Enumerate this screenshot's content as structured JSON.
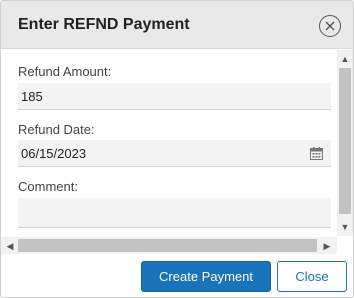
{
  "dialog": {
    "title": "Enter REFND Payment",
    "close_icon": "close-circle-icon"
  },
  "form": {
    "refund_amount_label": "Refund Amount:",
    "refund_amount_value": "185",
    "refund_date_label": "Refund Date:",
    "refund_date_value": "06/15/2023",
    "calendar_icon": "calendar-icon",
    "comment_label": "Comment:",
    "comment_value": ""
  },
  "footer": {
    "create_label": "Create Payment",
    "close_label": "Close"
  },
  "colors": {
    "primary": "#1a73b8",
    "header_bg": "#e9e9e9",
    "field_bg": "#f3f3f3"
  }
}
